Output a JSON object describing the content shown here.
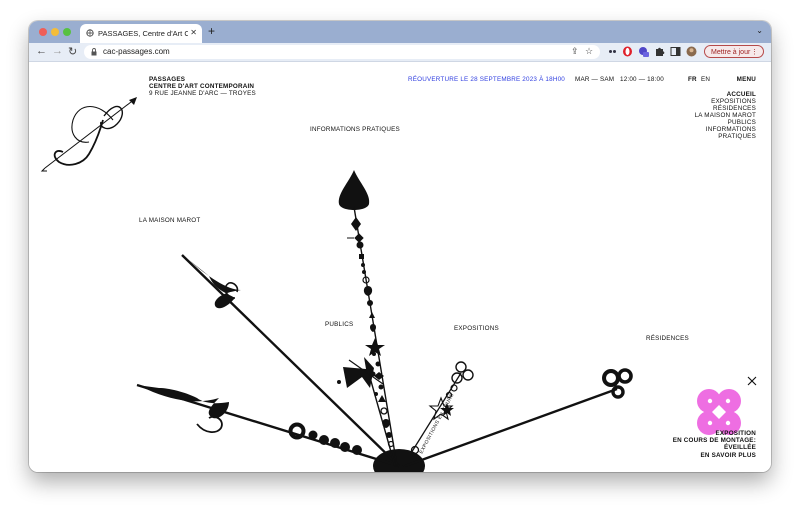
{
  "browser": {
    "tab_title": "PASSAGES, Centre d'Art Contem",
    "url": "cac-passages.com",
    "update_button": "Mettre à jour"
  },
  "site": {
    "logo_letter": "P",
    "brand": {
      "line1": "PASSAGES",
      "line2": "CENTRE D'ART CONTEMPORAIN",
      "line3": "9 RUE JEANNE D'ARC — TROYES"
    },
    "announcement": "RÉOUVERTURE LE 28 SEPTEMBRE 2023 À 18H00",
    "hours_days": "MAR — SAM",
    "hours_time": "12:00 — 18:00",
    "lang_fr": "FR",
    "lang_en": "EN",
    "menu_label": "MENU",
    "menu_items": [
      "ACCUEIL",
      "EXPOSITIONS",
      "RÉSIDENCES",
      "LA MAISON MAROT",
      "PUBLICS",
      "INFORMATIONS",
      "PRATIQUES"
    ],
    "compass_labels": {
      "informations": "INFORMATIONS PRATIQUES",
      "maison": "LA MAISON MAROT",
      "publics": "PUBLICS",
      "expositions": "EXPOSITIONS",
      "residences": "RÉSIDENCES",
      "rotated": "EXPOSITIONS EN COURS"
    },
    "promo": {
      "line1": "EXPOSITION",
      "line2": "EN COURS DE MONTAGE:",
      "line3": "ÉVEILLÉE",
      "line4": "EN SAVOIR PLUS"
    },
    "colors": {
      "announcement": "#2f3ee0",
      "flower": "#ee6ee2",
      "tabbar": "#9aaed0"
    }
  }
}
